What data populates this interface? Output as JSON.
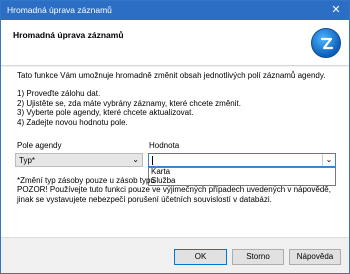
{
  "window": {
    "title": "Hromadná úprava záznamů",
    "close_glyph": "✕"
  },
  "header": {
    "heading": "Hromadná úprava záznamů",
    "logo_icon": "money-s3-logo-icon"
  },
  "intro_text": "Tato funkce Vám umožnuje hromadně změnit obsah jednotlivých polí záznamů agendy.",
  "steps": [
    "1) Proveďte zálohu dat.",
    "2) Ujistěte se, zda máte vybrány záznamy, které chcete změnit.",
    "3) Vyberte pole agendy, které chcete aktualizovat.",
    "4) Zadejte novou hodnotu pole."
  ],
  "field": {
    "label": "Pole agendy",
    "selected": "Typ*"
  },
  "value": {
    "label": "Hodnota",
    "current": ""
  },
  "dropdown_options": [
    "Karta",
    "Služba"
  ],
  "note": "*Změní typ zásoby pouze u zásob typu",
  "warning": "POZOR! Používejte tuto funkci pouze ve výjimečných případech uvedených v nápovědě, jinak se vystavujete nebezpečí porušení účetních souvislostí v databázi.",
  "buttons": {
    "ok": "OK",
    "cancel": "Storno",
    "help": "Nápověda"
  }
}
